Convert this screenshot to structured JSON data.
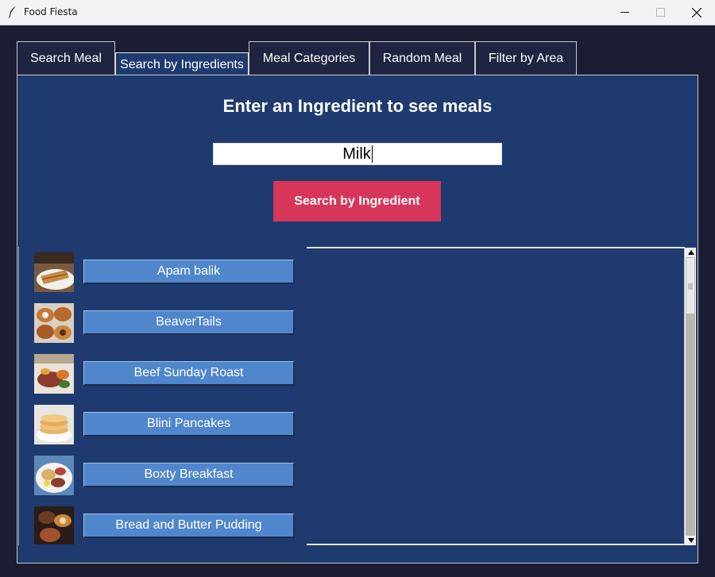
{
  "window": {
    "title": "Food Fiesta",
    "icons": {
      "app": "feather-icon",
      "minimize": "minimize-icon",
      "maximize": "maximize-icon",
      "close": "close-icon"
    }
  },
  "tabs": [
    {
      "label": "Search Meal",
      "active": false
    },
    {
      "label": "Search by Ingredients",
      "active": true
    },
    {
      "label": "Meal Categories",
      "active": false
    },
    {
      "label": "Random Meal",
      "active": false
    },
    {
      "label": "Filter by Area",
      "active": false
    }
  ],
  "search": {
    "heading": "Enter an Ingredient to see meals",
    "input_value": "Milk",
    "button_label": "Search by Ingredient"
  },
  "results": [
    {
      "name": "Apam balik"
    },
    {
      "name": "BeaverTails"
    },
    {
      "name": "Beef Sunday Roast"
    },
    {
      "name": "Blini Pancakes"
    },
    {
      "name": "Boxty Breakfast"
    },
    {
      "name": "Bread and Butter Pudding"
    }
  ],
  "colors": {
    "background": "#1b1e33",
    "panel": "#1f3a6e",
    "accent_button": "#d6365a",
    "result_button": "#5087cc"
  }
}
